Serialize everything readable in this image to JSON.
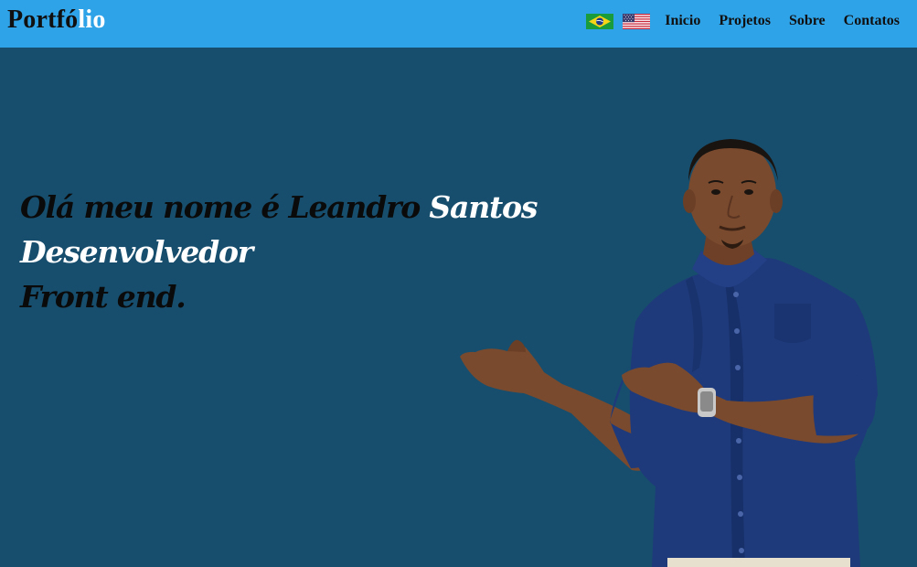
{
  "header": {
    "logo_part1": "Portfó",
    "logo_part2": "lio",
    "flags": [
      {
        "name": "brazil-flag",
        "label": "Português"
      },
      {
        "name": "usa-flag",
        "label": "English"
      }
    ],
    "nav": [
      {
        "label": "Inicio"
      },
      {
        "label": "Projetos"
      },
      {
        "label": "Sobre"
      },
      {
        "label": "Contatos"
      }
    ]
  },
  "hero": {
    "line1_dark": "Olá meu nome é Leandro",
    "line1_light": "Santos",
    "line2": "Desenvolvedor",
    "line3": "Front end."
  },
  "colors": {
    "header_bg": "#2fa3e8",
    "hero_bg": "#174e6d",
    "shirt": "#1f3a7a",
    "text_dark": "#0a0a0a",
    "text_light": "#ffffff"
  }
}
